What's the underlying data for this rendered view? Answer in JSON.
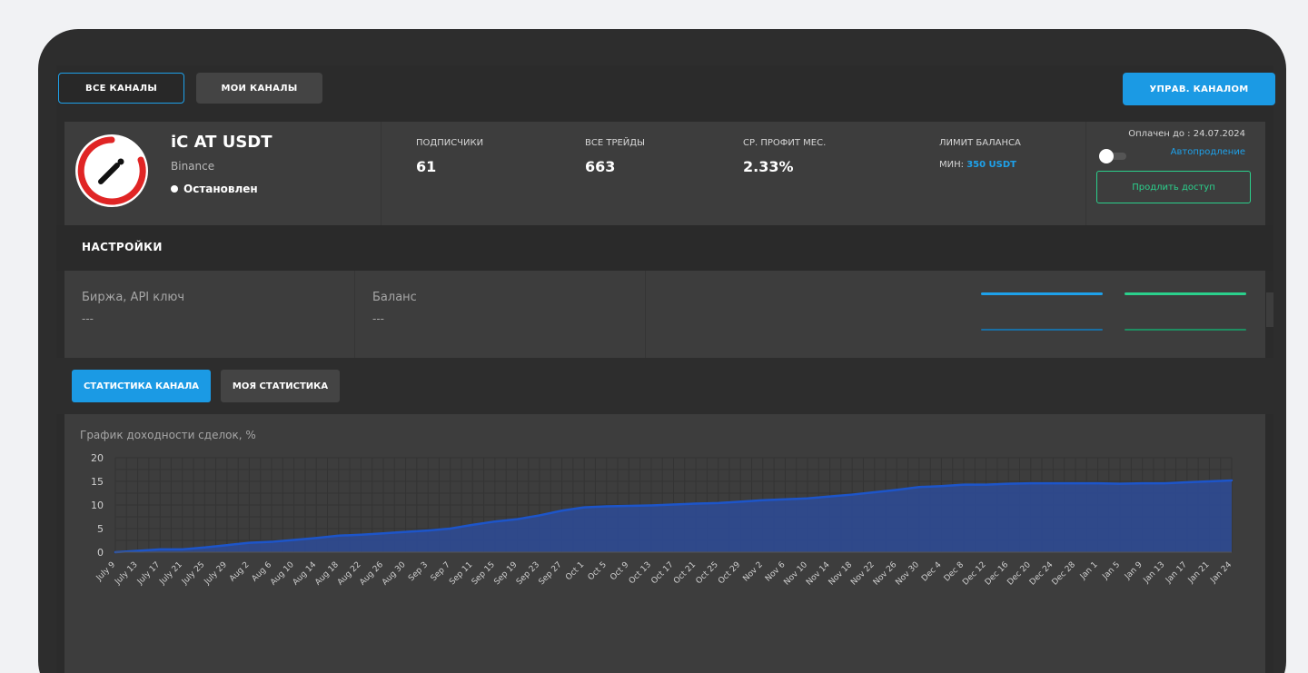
{
  "tabs": {
    "all_channels": "ВСЕ КАНАЛЫ",
    "my_channels": "МОИ КАНАЛЫ",
    "manage": "УПРАВ. КАНАЛОМ"
  },
  "channel": {
    "name": "iC AT USDT",
    "exchange": "Binance",
    "status": "Остановлен",
    "stats": {
      "subscribers_label": "ПОДПИСЧИКИ",
      "subscribers": "61",
      "trades_label": "ВСЕ ТРЕЙДЫ",
      "trades": "663",
      "profit_label": "СР. ПРОФИТ МЕС.",
      "profit": "2.33%",
      "limit_label": "ЛИМИТ БАЛАНСА",
      "limit_prefix": "МИН:",
      "limit_value": "350 USDT"
    },
    "paid_until": "Оплачен до : 24.07.2024",
    "autorenew": "Автопродление",
    "autorenew_on": false,
    "extend_button": "Продлить доступ"
  },
  "settings": {
    "title": "НАСТРОЙКИ",
    "exchange_api_label": "Биржа, API ключ",
    "exchange_api_value": "---",
    "balance_label": "Баланс",
    "balance_value": "---"
  },
  "stats_tabs": {
    "channel_stats": "СТАТИСТИКА КАНАЛА",
    "my_stats": "МОЯ СТАТИСТИКА"
  },
  "colors": {
    "accent": "#1b9ae4",
    "green": "#2bd08c",
    "area_fill": "#2e4a8e",
    "line": "#1d55c9"
  },
  "chart_data": {
    "type": "area",
    "title": "График доходности сделок, %",
    "ylim": [
      0,
      20
    ],
    "yticks": [
      0,
      5,
      10,
      15,
      20
    ],
    "grid": true,
    "x": [
      "July 9",
      "July 13",
      "July 17",
      "July 21",
      "July 25",
      "July 29",
      "Aug 2",
      "Aug 6",
      "Aug 10",
      "Aug 14",
      "Aug 18",
      "Aug 22",
      "Aug 26",
      "Aug 30",
      "Sep 3",
      "Sep 7",
      "Sep 11",
      "Sep 15",
      "Sep 19",
      "Sep 23",
      "Sep 27",
      "Oct 1",
      "Oct 5",
      "Oct 9",
      "Oct 13",
      "Oct 17",
      "Oct 21",
      "Oct 25",
      "Oct 29",
      "Nov 2",
      "Nov 6",
      "Nov 10",
      "Nov 14",
      "Nov 18",
      "Nov 22",
      "Nov 26",
      "Nov 30",
      "Dec 4",
      "Dec 8",
      "Dec 12",
      "Dec 16",
      "Dec 20",
      "Dec 24",
      "Dec 28",
      "Jan 1",
      "Jan 5",
      "Jan 9",
      "Jan 13",
      "Jan 17",
      "Jan 21",
      "Jan 24"
    ],
    "values": [
      0,
      0.3,
      0.6,
      0.6,
      1.0,
      1.5,
      2.0,
      2.2,
      2.6,
      3.0,
      3.5,
      3.7,
      4.0,
      4.3,
      4.6,
      5.0,
      5.8,
      6.5,
      7.0,
      7.8,
      8.8,
      9.5,
      9.7,
      9.8,
      9.9,
      10.1,
      10.3,
      10.4,
      10.7,
      11.0,
      11.2,
      11.4,
      11.8,
      12.2,
      12.7,
      13.2,
      13.8,
      14.0,
      14.3,
      14.3,
      14.5,
      14.6,
      14.6,
      14.6,
      14.6,
      14.5,
      14.6,
      14.6,
      14.8,
      15.0,
      15.2
    ]
  }
}
